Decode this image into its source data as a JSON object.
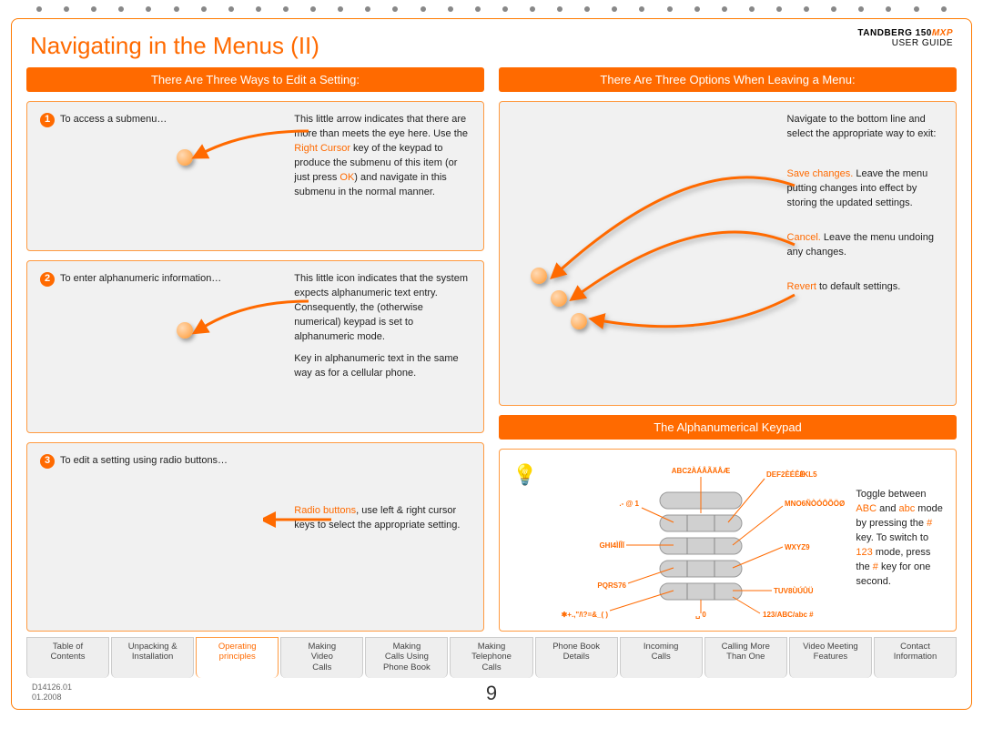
{
  "header": {
    "title": "Navigating in the Menus (II)",
    "brand": "TANDBERG",
    "model_num": "150",
    "model_suffix": "MXP",
    "subtitle": "USER GUIDE"
  },
  "left": {
    "bar": "There Are Three Ways to Edit a Setting:",
    "box1": {
      "lead": "To access a submenu…",
      "body_pre": "This little arrow indicates that there are more than meets the eye here. Use the ",
      "hl1": "Right Cursor",
      "body_mid": " key of the keypad to produce the submenu of this item (or just press ",
      "hl2": "OK",
      "body_post": ") and navigate in this submenu in the normal manner."
    },
    "box2": {
      "lead": "To enter alphanumeric information…",
      "p1": "This little icon indicates that the system expects alphanumeric text entry. Consequently, the (otherwise numerical) keypad is set to alphanumeric mode.",
      "p2": "Key in alphanumeric text in the same way as for a cellular phone."
    },
    "box3": {
      "lead": "To edit a setting using radio buttons…",
      "hl": "Radio buttons",
      "rest": ", use left & right cursor keys to select the appropriate setting."
    }
  },
  "right": {
    "bar1": "There Are Three Options When Leaving a Menu:",
    "box1": {
      "intro": "Navigate to the bottom line and select the appropriate way to exit:",
      "opt1_hl": "Save changes.",
      "opt1_rest": " Leave the menu putting changes into effect by storing the updated settings.",
      "opt2_hl": "Cancel.",
      "opt2_rest": " Leave the menu undoing any changes.",
      "opt3_hl": "Revert",
      "opt3_rest": " to default settings."
    },
    "bar2": "The Alphanumerical Keypad",
    "keypad": {
      "k1": ".- @ 1",
      "k2": "ABC2ÀÁÂÃÄÅÆ",
      "k3": "DEF2ÈÉÊË",
      "k4": "GHI4ÌÍÎÏ",
      "k5": "JKL5",
      "k6": "MNO6ÑÒÓÔÕÖØ",
      "k7": "PQRS76",
      "k8": "TUV8ÙÚÛÜ",
      "k9": "WXYZ9",
      "kstar": "✱+.,\"/\\?=&_( )",
      "k0": "␣ 0",
      "khash": "123/ABC/abc #",
      "desc_pre": "Toggle between ",
      "desc_abc": "ABC",
      "desc_mid1": " and ",
      "desc_abc2": "abc",
      "desc_mid2": " mode by pressing the ",
      "desc_hash1": "#",
      "desc_mid3": " key. To switch to ",
      "desc_123": "123",
      "desc_mid4": " mode, press the ",
      "desc_hash2": "#",
      "desc_end": " key for one second."
    }
  },
  "tabs": [
    {
      "l1": "Table of",
      "l2": "Contents"
    },
    {
      "l1": "Unpacking &",
      "l2": "Installation"
    },
    {
      "l1": "Operating",
      "l2": "principles"
    },
    {
      "l1": "Making",
      "l2": "Video",
      "l3": "Calls"
    },
    {
      "l1": "Making",
      "l2": "Calls Using",
      "l3": "Phone Book"
    },
    {
      "l1": "Making",
      "l2": "Telephone",
      "l3": "Calls"
    },
    {
      "l1": "Phone Book",
      "l2": "Details"
    },
    {
      "l1": "Incoming",
      "l2": "Calls"
    },
    {
      "l1": "Calling More",
      "l2": "Than One"
    },
    {
      "l1": "Video Meeting",
      "l2": "Features"
    },
    {
      "l1": "Contact",
      "l2": "Information"
    }
  ],
  "active_tab_index": 2,
  "footer": {
    "doc": "D14126.01",
    "date": "01.2008",
    "page": "9"
  }
}
